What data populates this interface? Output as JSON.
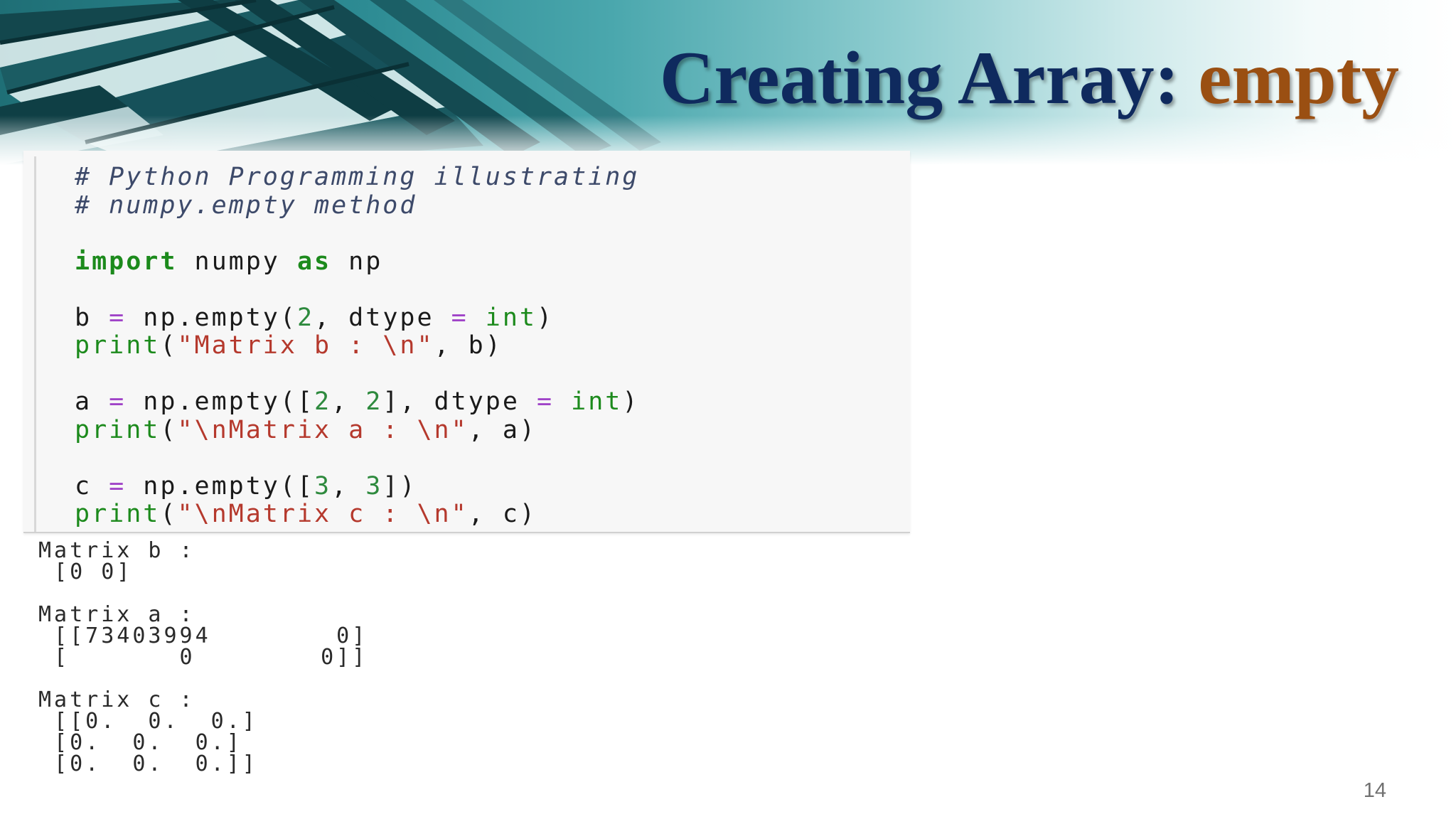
{
  "slide": {
    "title": "Creating Array:",
    "title_accent": "empty",
    "page_number": "14"
  },
  "colors": {
    "title": "#0f2a5e",
    "title_accent": "#9a4f12",
    "banner_teal": "#2d8b93"
  },
  "code": [
    [
      {
        "t": "# Python Programming illustrating",
        "c": "comment"
      }
    ],
    [
      {
        "t": "# numpy.empty method",
        "c": "comment"
      }
    ],
    [
      {
        "t": "",
        "c": "name"
      }
    ],
    [
      {
        "t": "import",
        "c": "keyword"
      },
      {
        "t": " numpy ",
        "c": "name"
      },
      {
        "t": "as",
        "c": "keyword"
      },
      {
        "t": " np",
        "c": "name"
      }
    ],
    [
      {
        "t": "",
        "c": "name"
      }
    ],
    [
      {
        "t": "b ",
        "c": "name"
      },
      {
        "t": "=",
        "c": "op"
      },
      {
        "t": " np.empty(",
        "c": "name"
      },
      {
        "t": "2",
        "c": "number"
      },
      {
        "t": ", dtype ",
        "c": "name"
      },
      {
        "t": "=",
        "c": "op"
      },
      {
        "t": " ",
        "c": "name"
      },
      {
        "t": "int",
        "c": "builtin"
      },
      {
        "t": ")",
        "c": "name"
      }
    ],
    [
      {
        "t": "print",
        "c": "builtin"
      },
      {
        "t": "(",
        "c": "name"
      },
      {
        "t": "\"Matrix b : \\n\"",
        "c": "string"
      },
      {
        "t": ", b)",
        "c": "name"
      }
    ],
    [
      {
        "t": "",
        "c": "name"
      }
    ],
    [
      {
        "t": "a ",
        "c": "name"
      },
      {
        "t": "=",
        "c": "op"
      },
      {
        "t": " np.empty([",
        "c": "name"
      },
      {
        "t": "2",
        "c": "number"
      },
      {
        "t": ", ",
        "c": "name"
      },
      {
        "t": "2",
        "c": "number"
      },
      {
        "t": "], dtype ",
        "c": "name"
      },
      {
        "t": "=",
        "c": "op"
      },
      {
        "t": " ",
        "c": "name"
      },
      {
        "t": "int",
        "c": "builtin"
      },
      {
        "t": ")",
        "c": "name"
      }
    ],
    [
      {
        "t": "print",
        "c": "builtin"
      },
      {
        "t": "(",
        "c": "name"
      },
      {
        "t": "\"\\nMatrix a : \\n\"",
        "c": "string"
      },
      {
        "t": ", a)",
        "c": "name"
      }
    ],
    [
      {
        "t": "",
        "c": "name"
      }
    ],
    [
      {
        "t": "c ",
        "c": "name"
      },
      {
        "t": "=",
        "c": "op"
      },
      {
        "t": " np.empty([",
        "c": "name"
      },
      {
        "t": "3",
        "c": "number"
      },
      {
        "t": ", ",
        "c": "name"
      },
      {
        "t": "3",
        "c": "number"
      },
      {
        "t": "])",
        "c": "name"
      }
    ],
    [
      {
        "t": "print",
        "c": "builtin"
      },
      {
        "t": "(",
        "c": "name"
      },
      {
        "t": "\"\\nMatrix c : \\n\"",
        "c": "string"
      },
      {
        "t": ", c)",
        "c": "name"
      }
    ]
  ],
  "output": [
    "Matrix b :",
    " [0 0]",
    "",
    "Matrix a :",
    " [[73403994        0]",
    " [       0        0]]",
    "",
    "Matrix c :",
    " [[0.  0.  0.]",
    " [0.  0.  0.]",
    " [0.  0.  0.]]"
  ]
}
